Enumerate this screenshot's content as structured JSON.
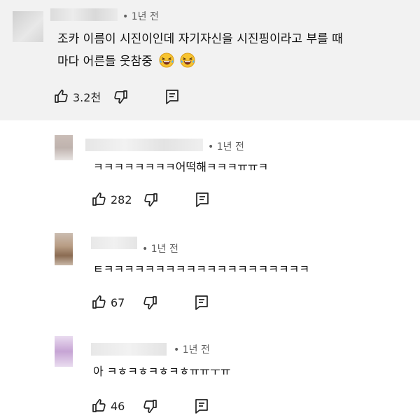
{
  "colors": {
    "main_bg": "#f2f2f2",
    "text": "#111111",
    "meta": "#606060"
  },
  "main_comment": {
    "time": "• 1년 전",
    "text_line1": "조카 이름이 시진이인데 자기자신을 시진핑이라고 부를 때",
    "text_line2": "마다 어른들 웃참중",
    "emoji": "face-with-tears-of-joy",
    "likes": "3.2천"
  },
  "replies": [
    {
      "time": "• 1년 전",
      "text": "ㅋㅋㅋㅋㅋㅋㅋㅋ어떡해ㅋㅋㅋㅠㅠㅋ",
      "likes": "282"
    },
    {
      "time": "• 1년 전",
      "text": "ㅌㅋㅋㅋㅋㅋㅋㅋㅋㅋㅋㅋㅋㅋㅋㅋㅋㅋㅋㅋㅋ",
      "likes": "67"
    },
    {
      "time": "• 1년 전",
      "text": "아 ㅋㅎㅋㅎㅋㅎㅋㅎㅠㅠㅜㅠ",
      "likes": "46"
    }
  ],
  "icons": {
    "like": "thumbs-up-icon",
    "dislike": "thumbs-down-icon",
    "reply": "reply-icon"
  }
}
